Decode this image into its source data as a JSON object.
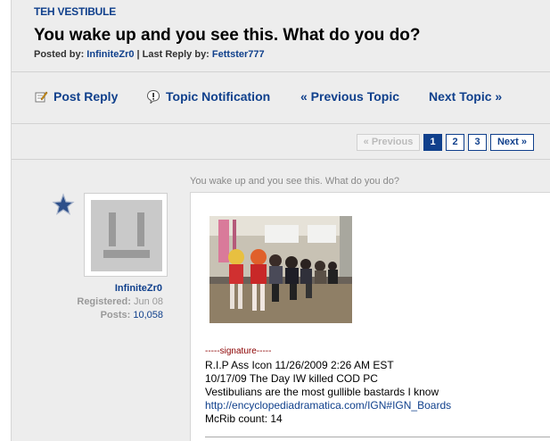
{
  "forum": {
    "name": "TEH VESTIBULE"
  },
  "topic": {
    "title": "You wake up and you see this. What do you do?",
    "posted_by_label": "Posted by:",
    "posted_by": "InfiniteZr0",
    "last_reply_label": "| Last Reply by:",
    "last_reply_by": "Fettster777"
  },
  "actions": {
    "post_reply": "Post Reply",
    "topic_notification": "Topic Notification",
    "previous_topic": "« Previous Topic",
    "next_topic": "Next Topic »"
  },
  "pagination": {
    "previous": "« Previous",
    "current": "1",
    "pages": [
      "2",
      "3"
    ],
    "next": "Next »"
  },
  "post": {
    "subject": "You wake up and you see this. What do you do?",
    "author": {
      "name": "InfiniteZr0",
      "registered_label": "Registered:",
      "registered": "Jun 08",
      "posts_label": "Posts:",
      "posts": "10,058"
    },
    "signature": {
      "header": "-----signature-----",
      "lines": [
        "R.I.P Ass Icon 11/26/2009 2:26 AM EST",
        "10/17/09 The Day IW killed COD PC",
        "Vestibulians are the most gullible bastards I know"
      ],
      "link": "http://encyclopediadramatica.com/IGN#IGN_Boards",
      "last_line": "McRib count: 14"
    }
  },
  "colors": {
    "link": "#10408c",
    "background": "#ededed",
    "signature_header": "#8b0000"
  },
  "icons": [
    "post-reply-icon",
    "topic-notification-icon",
    "user-rank-star-icon",
    "default-avatar-icon"
  ]
}
